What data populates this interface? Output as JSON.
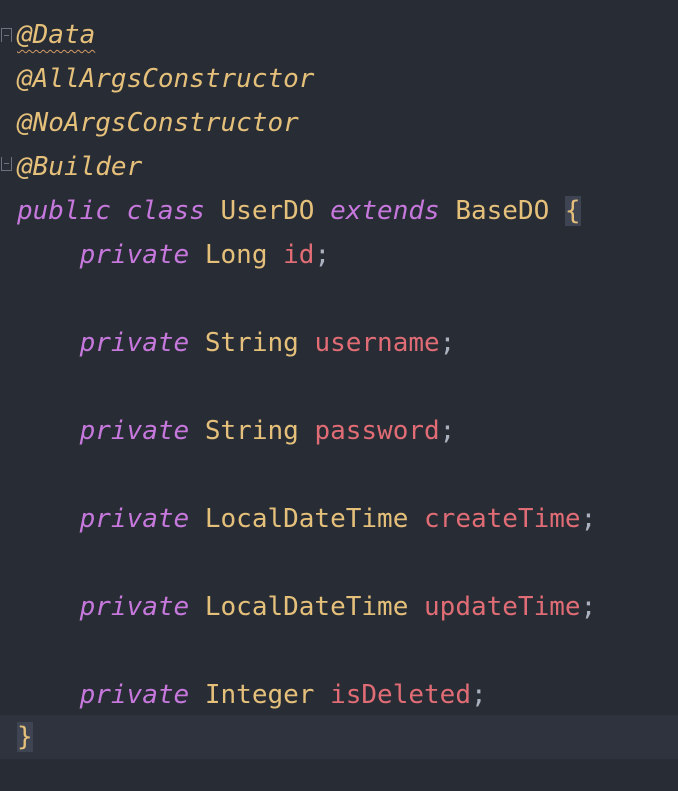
{
  "code": {
    "annotations": [
      "@Data",
      "@AllArgsConstructor",
      "@NoArgsConstructor",
      "@Builder"
    ],
    "class_decl": {
      "public_kw": "public",
      "class_kw": "class",
      "class_name": "UserDO",
      "extends_kw": "extends",
      "parent": "BaseDO",
      "open_brace": "{"
    },
    "fields": [
      {
        "modifier": "private",
        "type": "Long",
        "name": "id"
      },
      {
        "modifier": "private",
        "type": "String",
        "name": "username"
      },
      {
        "modifier": "private",
        "type": "String",
        "name": "password"
      },
      {
        "modifier": "private",
        "type": "LocalDateTime",
        "name": "createTime"
      },
      {
        "modifier": "private",
        "type": "LocalDateTime",
        "name": "updateTime"
      },
      {
        "modifier": "private",
        "type": "Integer",
        "name": "isDeleted"
      }
    ],
    "semicolon": ";",
    "close_brace": "}"
  },
  "colors": {
    "background": "#282c34",
    "annotation": "#e5c07b",
    "keyword": "#c678dd",
    "type": "#e5c07b",
    "field": "#e06c75",
    "punctuation": "#abb2bf"
  }
}
